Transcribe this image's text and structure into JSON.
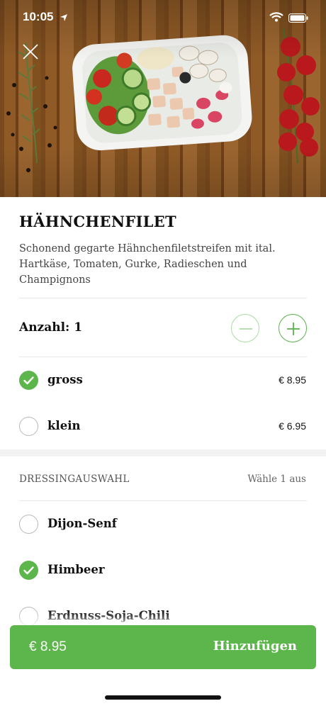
{
  "status_bar": {
    "time": "10:05",
    "nav_icon": "location-arrow-icon",
    "wifi_icon": "wifi-icon",
    "battery_icon": "battery-icon"
  },
  "hero": {
    "image": "salad-bowl-photo",
    "close_icon": "close-icon"
  },
  "product": {
    "title": "HÄHNCHENFILET",
    "description": "Schonend gegarte Hähnchenfiletstreifen mit ital. Hartkäse, Tomaten, Gurke, Radieschen und Champignons"
  },
  "quantity": {
    "label": "Anzahl: 1",
    "minus_icon": "minus-icon",
    "plus_icon": "plus-icon"
  },
  "sizes": [
    {
      "label": "gross",
      "price": "€ 8.95",
      "selected": true
    },
    {
      "label": "klein",
      "price": "€ 6.95",
      "selected": false
    }
  ],
  "dressing": {
    "header": "DRESSINGAUSWAHL",
    "hint": "Wähle 1 aus",
    "options": [
      {
        "label": "Dijon-Senf",
        "selected": false
      },
      {
        "label": "Himbeer",
        "selected": true
      },
      {
        "label": "Erdnuss-Soja-Chili",
        "selected": false
      }
    ]
  },
  "cart": {
    "price": "€ 8.95",
    "button_label": "Hinzufügen"
  },
  "colors": {
    "accent": "#5cb64b",
    "accent_light": "#a9dca2"
  }
}
